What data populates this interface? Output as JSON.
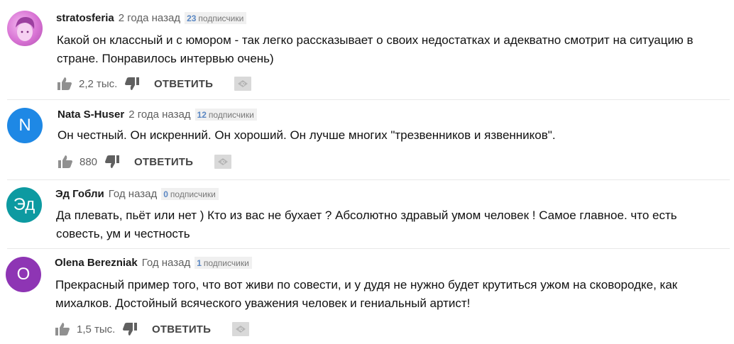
{
  "comments": [
    {
      "author": "stratosferia",
      "time": "2 года назад",
      "subs_count": "23",
      "subs_label": "подписчики",
      "text": "Какой он классный и с юмором - так легко рассказывает о своих недостатках и адекватно смотрит на ситуацию в стране. Понравилось интервью очень)",
      "likes": "2,2 тыс.",
      "reply_label": "ОТВЕТИТЬ",
      "avatar_letter": "",
      "avatar_color": "#d873d4"
    },
    {
      "author": "Nata S-Huser",
      "time": "2 года назад",
      "subs_count": "12",
      "subs_label": "подписчики",
      "text": "Он честный. Он искренний. Он хороший. Он лучше многих \"трезвенников и язвенников\".",
      "likes": "880",
      "reply_label": "ОТВЕТИТЬ",
      "avatar_letter": "N",
      "avatar_color": "#1e88e5"
    },
    {
      "author": "Эд Гобли",
      "time": "Год назад",
      "subs_count": "0",
      "subs_label": "подписчики",
      "text": "Да плевать, пьёт или нет ) Кто из вас не бухает ? Абсолютно здравый умом человек ! Самое главное. что есть совесть, ум и честность",
      "likes": "",
      "reply_label": "",
      "avatar_letter": "Эд",
      "avatar_color": "#0d9aa1"
    },
    {
      "author": "Olena Berezniak",
      "time": "Год назад",
      "subs_count": "1",
      "subs_label": "подписчики",
      "text": "Прекрасный пример того, что вот живи по совести, и у дудя не нужно будет крутиться ужом на сковородке, как михалков. Достойный всяческого уважения человек и гениальный артист!",
      "likes": "1,5 тыс.",
      "reply_label": "ОТВЕТИТЬ",
      "avatar_letter": "O",
      "avatar_color": "#8e35b4"
    }
  ]
}
